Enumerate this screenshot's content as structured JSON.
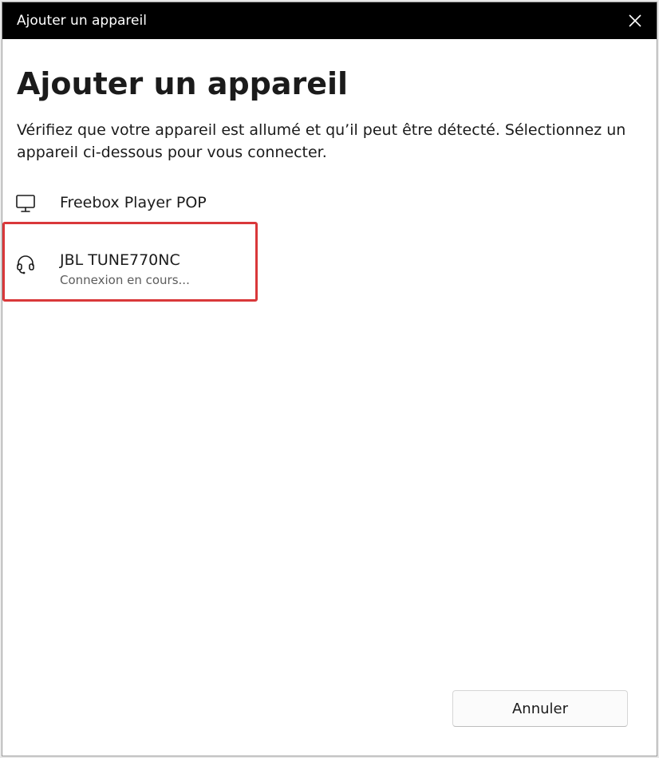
{
  "window": {
    "title": "Ajouter un appareil",
    "close_icon": "close-icon"
  },
  "main": {
    "heading": "Ajouter un appareil",
    "description": "Vérifiez que votre appareil est allumé et qu’il peut être détecté. Sélectionnez un appareil ci-dessous pour vous connecter."
  },
  "devices": [
    {
      "name": "Freebox Player POP",
      "status": "",
      "icon": "monitor-icon"
    },
    {
      "name": "JBL TUNE770NC",
      "status": "Connexion en cours...",
      "icon": "headset-icon"
    }
  ],
  "footer": {
    "cancel_label": "Annuler"
  },
  "colors": {
    "titlebar": "#000000",
    "highlight": "#d9383a"
  }
}
